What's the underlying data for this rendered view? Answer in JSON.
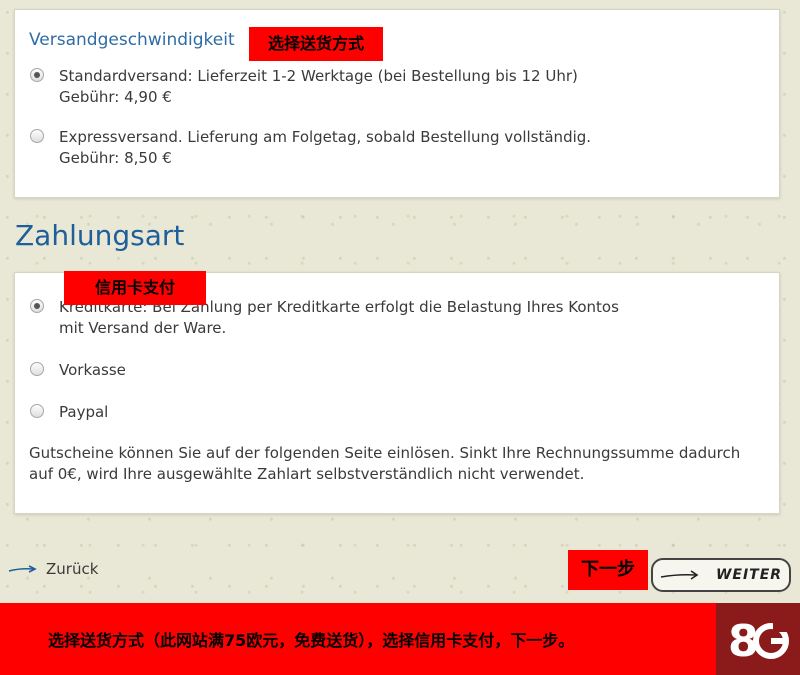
{
  "shipping": {
    "title": "Versandgeschwindigkeit",
    "annotation": "选择送货方式",
    "options": [
      {
        "line1": "Standardversand: Lieferzeit 1-2 Werktage (bei Bestellung bis 12 Uhr)",
        "line2": "Gebühr: 4,90 €",
        "selected": true
      },
      {
        "line1": "Expressversand. Lieferung am Folgetag, sobald Bestellung vollständig.",
        "line2": "Gebühr: 8,50 €",
        "selected": false
      }
    ]
  },
  "payment": {
    "title": "Zahlungsart",
    "annotation": "信用卡支付",
    "options": [
      {
        "line1": "Kreditkarte: Bei Zahlung per Kreditkarte erfolgt die Belastung Ihres Kontos",
        "line2": "mit Versand der Ware.",
        "selected": true
      },
      {
        "line1": "Vorkasse",
        "selected": false
      },
      {
        "line1": "Paypal",
        "selected": false
      }
    ],
    "note": "Gutscheine können Sie auf der folgenden Seite einlösen. Sinkt Ihre Rechnungssumme dadurch auf 0€, wird Ihre ausgewählte Zahlart selbstverständlich nicht verwendet."
  },
  "nav": {
    "back_label": "Zurück",
    "next_label": "WEITER",
    "next_annotation": "下一步"
  },
  "footer": {
    "text": "选择送货方式（此网站满75欧元，免费送货），选择信用卡支付，下一步。",
    "logo": "8G"
  }
}
